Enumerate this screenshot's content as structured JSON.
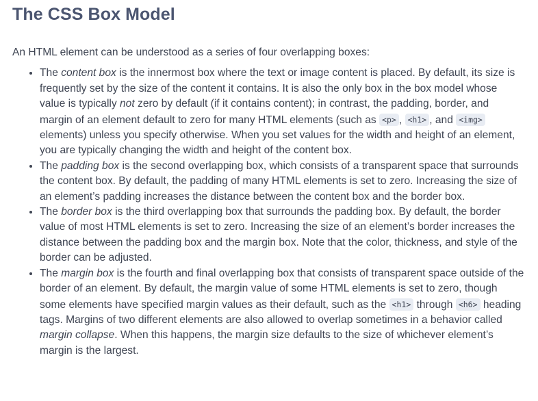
{
  "title": "The CSS Box Model",
  "intro": "An HTML element can be understood as a series of four overlapping boxes:",
  "items": [
    {
      "pre": "The ",
      "term": "content box",
      "text1": " is the innermost box where the text or image content is placed. By default, its size is frequently set by the size of the content it contains. It is also the only box in the box model whose value is typically ",
      "em2": "not",
      "text2": " zero by default (if it contains content); in contrast, the padding, border, and margin of an element default to zero for many HTML elements (such as ",
      "code1": "<p>",
      "sep1": ", ",
      "code2": "<h1>",
      "sep2": ", and ",
      "code3": "<img>",
      "text3": " elements) unless you specify otherwise. When you set values for the width and height of an element, you are typically changing the width and height of the content box."
    },
    {
      "pre": "The ",
      "term": "padding box",
      "text1": " is the second overlapping box, which consists of a transparent space that surrounds the content box. By default, the padding of many HTML elements is set to zero. Increasing the size of an element’s padding increases the distance between the content box and the border box."
    },
    {
      "pre": "The ",
      "term": "border box",
      "text1": " is the third overlapping box that surrounds the padding box. By default, the border value of most HTML elements is set to zero. Increasing the size of an element’s border increases the distance between the padding box and the margin box. Note that the color, thickness, and style of the border can be adjusted."
    },
    {
      "pre": "The ",
      "term": "margin box",
      "text1": " is the fourth and final overlapping box that consists of transparent space outside of the border of an element. By default, the margin value of some HTML elements is set to zero, though some elements have specified margin values as their default, such as the ",
      "code1": "<h1>",
      "sep1": " through ",
      "code2": "<h6>",
      "text2": " heading tags. Margins of two different elements are also allowed to overlap sometimes in a behavior called ",
      "em2": "margin collapse",
      "text3": ". When this happens, the margin size defaults to the size of whichever element’s margin is the largest."
    }
  ],
  "colors": {
    "heading": "#4b5570",
    "text": "#3f4553",
    "code_bg": "#e8ecf3"
  }
}
